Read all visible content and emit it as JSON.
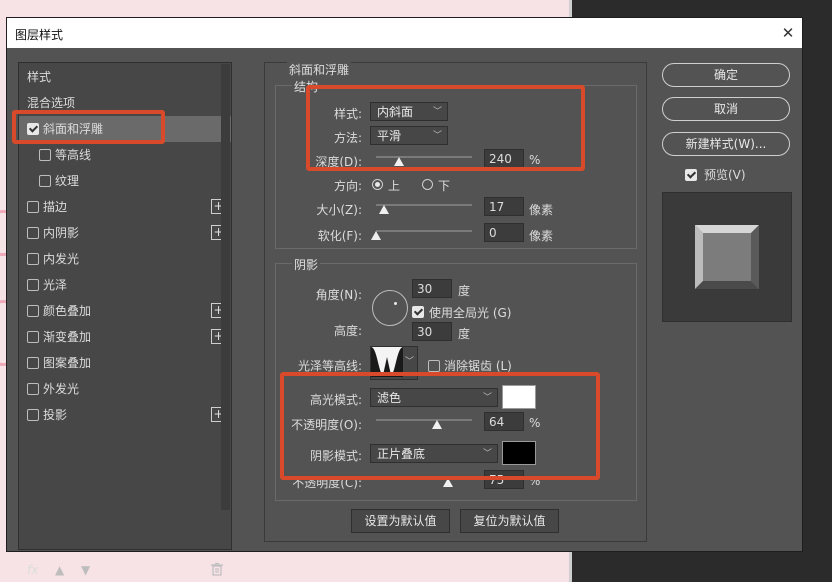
{
  "dialog": {
    "title": "图层样式",
    "close_glyph": "✕"
  },
  "styles": {
    "header": "样式",
    "items": [
      {
        "label": "混合选项",
        "checkbox": false,
        "checked": false,
        "plus": false,
        "indent": 0,
        "selected": false
      },
      {
        "label": "斜面和浮雕",
        "checkbox": true,
        "checked": true,
        "plus": false,
        "indent": 0,
        "selected": true
      },
      {
        "label": "等高线",
        "checkbox": true,
        "checked": false,
        "plus": false,
        "indent": 1,
        "selected": false
      },
      {
        "label": "纹理",
        "checkbox": true,
        "checked": false,
        "plus": false,
        "indent": 1,
        "selected": false
      },
      {
        "label": "描边",
        "checkbox": true,
        "checked": false,
        "plus": true,
        "indent": 0,
        "selected": false
      },
      {
        "label": "内阴影",
        "checkbox": true,
        "checked": false,
        "plus": true,
        "indent": 0,
        "selected": false
      },
      {
        "label": "内发光",
        "checkbox": true,
        "checked": false,
        "plus": false,
        "indent": 0,
        "selected": false
      },
      {
        "label": "光泽",
        "checkbox": true,
        "checked": false,
        "plus": false,
        "indent": 0,
        "selected": false
      },
      {
        "label": "颜色叠加",
        "checkbox": true,
        "checked": false,
        "plus": true,
        "indent": 0,
        "selected": false
      },
      {
        "label": "渐变叠加",
        "checkbox": true,
        "checked": false,
        "plus": true,
        "indent": 0,
        "selected": false
      },
      {
        "label": "图案叠加",
        "checkbox": true,
        "checked": false,
        "plus": false,
        "indent": 0,
        "selected": false
      },
      {
        "label": "外发光",
        "checkbox": true,
        "checked": false,
        "plus": false,
        "indent": 0,
        "selected": false
      },
      {
        "label": "投影",
        "checkbox": true,
        "checked": false,
        "plus": true,
        "indent": 0,
        "selected": false
      }
    ],
    "fx_label": "fx",
    "plus_glyph": "+"
  },
  "bevel": {
    "panel_title": "斜面和浮雕",
    "structure_title": "结构",
    "style_label": "样式:",
    "style_value": "内斜面",
    "technique_label": "方法:",
    "technique_value": "平滑",
    "depth_label": "深度(D):",
    "depth_value": "240",
    "depth_unit": "%",
    "depth_fraction": 0.24,
    "direction_label": "方向:",
    "direction_up": "上",
    "direction_down": "下",
    "direction_selected": "上",
    "size_label": "大小(Z):",
    "size_value": "17",
    "size_unit": "像素",
    "size_fraction": 0.08,
    "soften_label": "软化(F):",
    "soften_value": "0",
    "soften_unit": "像素",
    "soften_fraction": 0.0
  },
  "shading": {
    "title": "阴影",
    "angle_label": "角度(N):",
    "angle_value": "30",
    "angle_unit": "度",
    "global_light_label": "使用全局光 (G)",
    "global_light_checked": true,
    "altitude_label": "高度:",
    "altitude_value": "30",
    "altitude_unit": "度",
    "gloss_contour_label": "光泽等高线:",
    "antialias_label": "消除锯齿 (L)",
    "antialias_checked": false,
    "highlight_mode_label": "高光模式:",
    "highlight_mode_value": "滤色",
    "highlight_color": "#ffffff",
    "highlight_opacity_label": "不透明度(O):",
    "highlight_opacity_value": "64",
    "highlight_opacity_fraction": 0.64,
    "shadow_mode_label": "阴影模式:",
    "shadow_mode_value": "正片叠底",
    "shadow_color": "#000000",
    "shadow_opacity_label": "不透明度(C):",
    "shadow_opacity_value": "75",
    "shadow_opacity_fraction": 0.75,
    "opacity_unit": "%"
  },
  "footer_buttons": {
    "make_default": "设置为默认值",
    "reset_default": "复位为默认值"
  },
  "actions": {
    "ok": "确定",
    "cancel": "取消",
    "new_style": "新建样式(W)...",
    "preview_label": "预览(V)",
    "preview_checked": true
  },
  "colors": {
    "highlight_box": "#d94a2a",
    "dialog_bg": "#535353"
  }
}
